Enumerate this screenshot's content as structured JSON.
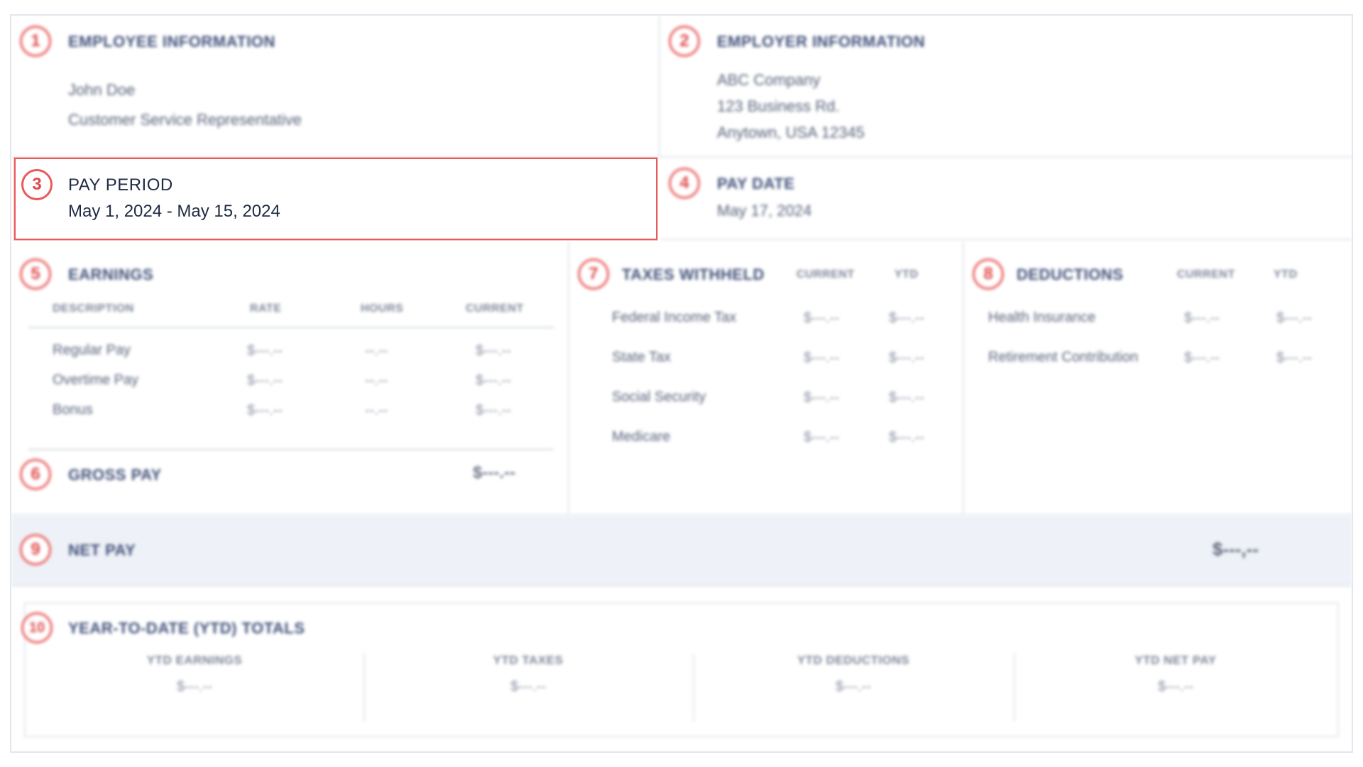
{
  "employee": {
    "number": "1",
    "title": "EMPLOYEE INFORMATION",
    "name": "John Doe",
    "role": "Customer Service Representative"
  },
  "employer": {
    "number": "2",
    "title": "EMPLOYER INFORMATION",
    "company": "ABC Company",
    "address1": "123 Business Rd.",
    "address2": "Anytown, USA 12345"
  },
  "pay_period": {
    "number": "3",
    "title": "PAY PERIOD",
    "value": "May 1, 2024 - May 15, 2024"
  },
  "pay_date": {
    "number": "4",
    "title": "PAY DATE",
    "value": "May 17, 2024"
  },
  "earnings": {
    "number": "5",
    "title": "EARNINGS",
    "columns": [
      "DESCRIPTION",
      "RATE",
      "HOURS",
      "CURRENT"
    ],
    "rows": [
      {
        "description": "Regular Pay",
        "rate": "$---.--",
        "hours": "--.--",
        "current": "$---.--"
      },
      {
        "description": "Overtime Pay",
        "rate": "$---.--",
        "hours": "--.--",
        "current": "$---.--"
      },
      {
        "description": "Bonus",
        "rate": "$---.--",
        "hours": "--.--",
        "current": "$---.--"
      }
    ]
  },
  "gross_pay": {
    "number": "6",
    "title": "GROSS PAY",
    "value": "$---.--"
  },
  "taxes": {
    "number": "7",
    "title": "TAXES WITHHELD",
    "columns": [
      "CURRENT",
      "YTD"
    ],
    "rows": [
      {
        "label": "Federal Income Tax",
        "current": "$---.--",
        "ytd": "$---.--"
      },
      {
        "label": "State Tax",
        "current": "$---.--",
        "ytd": "$---.--"
      },
      {
        "label": "Social Security",
        "current": "$---.--",
        "ytd": "$---.--"
      },
      {
        "label": "Medicare",
        "current": "$---.--",
        "ytd": "$---.--"
      }
    ]
  },
  "deductions": {
    "number": "8",
    "title": "DEDUCTIONS",
    "columns": [
      "CURRENT",
      "YTD"
    ],
    "rows": [
      {
        "label": "Health Insurance",
        "current": "$---.--",
        "ytd": "$---.--"
      },
      {
        "label": "Retirement Contribution",
        "current": "$---.--",
        "ytd": "$---.--"
      }
    ]
  },
  "net_pay": {
    "number": "9",
    "title": "NET PAY",
    "value": "$---,--"
  },
  "ytd": {
    "number": "10",
    "title": "YEAR-TO-DATE (YTD) TOTALS",
    "items": [
      {
        "label": "YTD EARNINGS",
        "value": "$---.--"
      },
      {
        "label": "YTD TAXES",
        "value": "$---.--"
      },
      {
        "label": "YTD DEDUCTIONS",
        "value": "$---.--"
      },
      {
        "label": "YTD NET PAY",
        "value": "$---.--"
      }
    ]
  },
  "colors": {
    "accent_red": "#e95a5a",
    "title_blue": "#3f4f78",
    "net_pay_band": "#eef1f7"
  }
}
